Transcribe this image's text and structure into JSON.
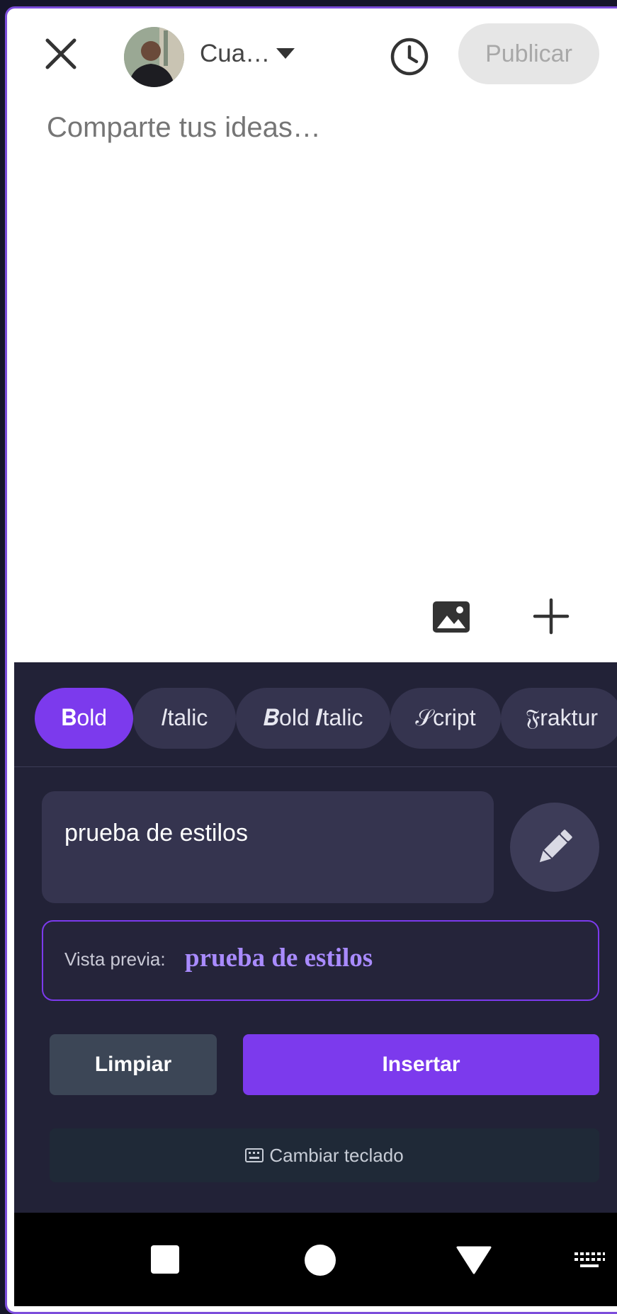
{
  "composer": {
    "account_name": "Cua…",
    "publish_label": "Publicar",
    "post_placeholder": "Comparte tus ideas…"
  },
  "style_tabs": [
    {
      "label": "𝐁old",
      "active": true
    },
    {
      "label": "𝐼talic",
      "active": false
    },
    {
      "label": "𝑩old 𝑰talic",
      "active": false
    },
    {
      "label": "𝒮cript",
      "active": false
    },
    {
      "label": "𝔉raktur",
      "active": false
    }
  ],
  "text_input": {
    "value": "prueba de estilos"
  },
  "preview": {
    "label": "Vista previa:",
    "text": "prueba de estilos"
  },
  "actions": {
    "clear_label": "Limpiar",
    "insert_label": "Insertar"
  },
  "switch_keyboard_label": "Cambiar teclado",
  "colors": {
    "accent": "#7c3aed",
    "panel_bg": "#222237",
    "chip_bg": "#35344f"
  }
}
